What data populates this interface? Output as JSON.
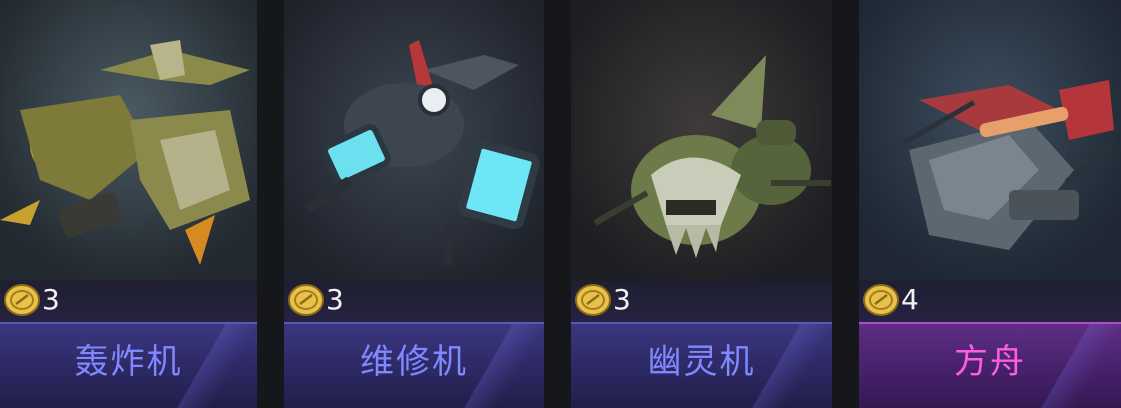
{
  "cards": [
    {
      "name": "轰炸机",
      "cost": "3",
      "rarity": "purple",
      "icon": "bomber-ship-art"
    },
    {
      "name": "维修机",
      "cost": "3",
      "rarity": "purple",
      "icon": "repair-ship-art"
    },
    {
      "name": "幽灵机",
      "cost": "3",
      "rarity": "purple",
      "icon": "ghost-ship-art"
    },
    {
      "name": "方舟",
      "cost": "4",
      "rarity": "pink",
      "icon": "ark-ship-art"
    }
  ],
  "colors": {
    "purple_text": "#7f88ff",
    "pink_text": "#ff5ce3",
    "coin": "#e8c24a"
  }
}
